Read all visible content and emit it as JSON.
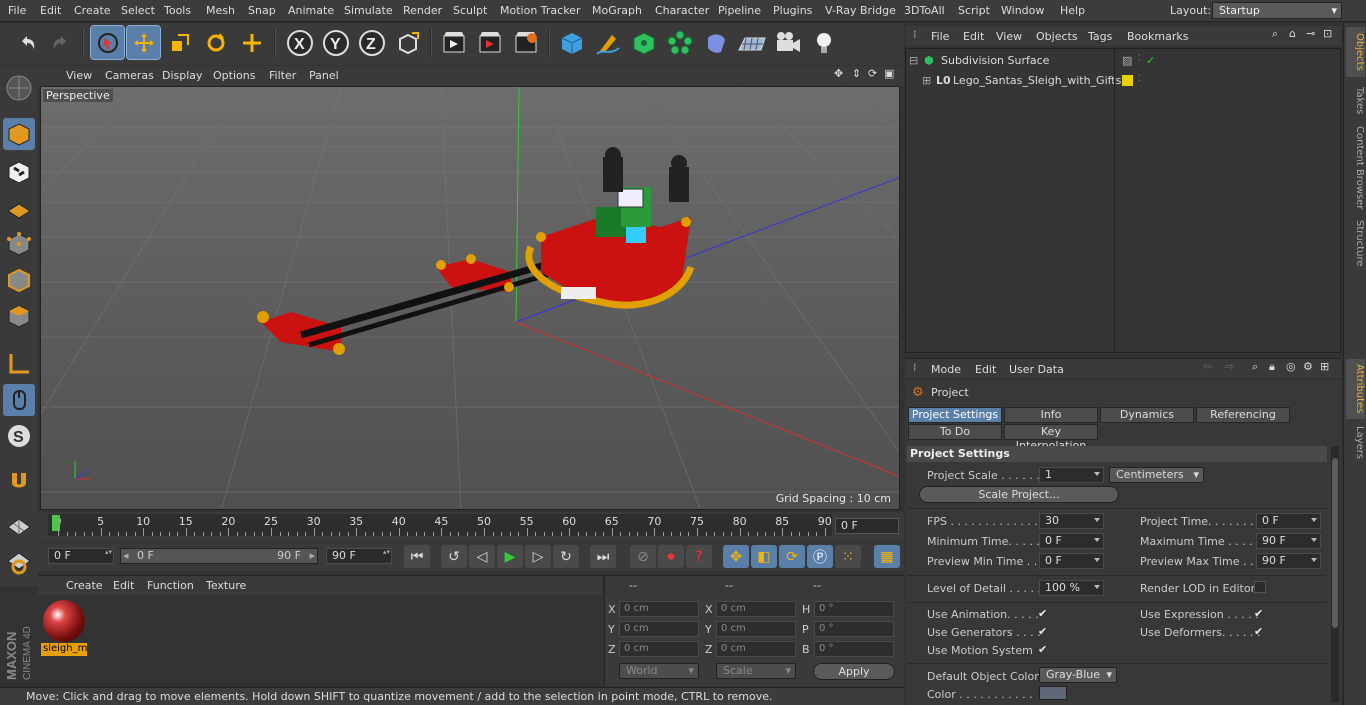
{
  "menubar": {
    "items": [
      "File",
      "Edit",
      "Create",
      "Select",
      "Tools",
      "Mesh",
      "Snap",
      "Animate",
      "Simulate",
      "Render",
      "Sculpt",
      "Motion Tracker",
      "MoGraph",
      "Character",
      "Pipeline",
      "Plugins",
      "V-Ray Bridge",
      "3DToAll",
      "Script",
      "Window",
      "Help"
    ],
    "layout_label": "Layout:",
    "layout_value": "Startup"
  },
  "toolbar": {
    "icons": [
      "undo-icon",
      "redo-icon",
      "live-selection-icon",
      "move-icon",
      "scale-icon",
      "rotate-icon",
      "last-tool-icon",
      "x-axis-icon",
      "y-axis-icon",
      "z-axis-icon",
      "coordinate-system-icon",
      "render-view-icon",
      "render-picture-viewer-icon",
      "edit-render-settings-icon",
      "cube-icon",
      "pen-icon",
      "subdivision-icon",
      "cloner-icon",
      "deformer-icon",
      "floor-icon",
      "camera-icon",
      "light-icon"
    ]
  },
  "viewport": {
    "menu": [
      "View",
      "Cameras",
      "Display",
      "Options",
      "Filter",
      "Panel"
    ],
    "label": "Perspective",
    "grid_spacing": "Grid Spacing : 10 cm"
  },
  "timeline": {
    "ticks": [
      "0",
      "5",
      "10",
      "15",
      "20",
      "25",
      "30",
      "35",
      "40",
      "45",
      "50",
      "55",
      "60",
      "65",
      "70",
      "75",
      "80",
      "85",
      "90"
    ],
    "current_frame": "0 F",
    "start": "0 F",
    "range_start": "0 F",
    "range_end": "90 F",
    "end": "90 F"
  },
  "material": {
    "menu": [
      "Create",
      "Edit",
      "Function",
      "Texture"
    ],
    "name": "sleigh_m"
  },
  "coords": {
    "headers": [
      "--",
      "--",
      "--"
    ],
    "rows": [
      {
        "a": "X",
        "av": "0 cm",
        "b": "X",
        "bv": "0 cm",
        "c": "H",
        "cv": "0 °"
      },
      {
        "a": "Y",
        "av": "0 cm",
        "b": "Y",
        "bv": "0 cm",
        "c": "P",
        "cv": "0 °"
      },
      {
        "a": "Z",
        "av": "0 cm",
        "b": "Z",
        "bv": "0 cm",
        "c": "B",
        "cv": "0 °"
      }
    ],
    "world": "World",
    "scale": "Scale",
    "apply": "Apply"
  },
  "status": "Move: Click and drag to move elements. Hold down SHIFT to quantize movement / add to the selection in point mode, CTRL to remove.",
  "objects": {
    "menu": [
      "File",
      "Edit",
      "View",
      "Objects",
      "Tags",
      "Bookmarks"
    ],
    "items": [
      {
        "name": "Subdivision Surface"
      },
      {
        "name": "Lego_Santas_Sleigh_with_Gifts"
      }
    ]
  },
  "attributes": {
    "menu": [
      "Mode",
      "Edit",
      "User Data"
    ],
    "title": "Project",
    "tabs": [
      "Project Settings",
      "Info",
      "Dynamics",
      "Referencing",
      "To Do",
      "Key Interpolation"
    ],
    "section": "Project Settings",
    "project_scale_label": "Project Scale . . . . . .",
    "project_scale_value": "1",
    "project_scale_unit": "Centimeters",
    "scale_project_btn": "Scale Project...",
    "fps_label": "FPS . . . . . . . . . . . . . .",
    "fps": "30",
    "project_time_label": "Project Time. . . . . . . .",
    "project_time": "0 F",
    "min_time_label": "Minimum Time. . . . . .",
    "min_time": "0 F",
    "max_time_label": "Maximum Time . . . . . .",
    "max_time": "90 F",
    "prev_min_label": "Preview Min Time . .",
    "prev_min": "0 F",
    "prev_max_label": "Preview Max Time . . .",
    "prev_max": "90 F",
    "lod_label": "Level of Detail . . . . .",
    "lod": "100 %",
    "render_lod_label": "Render LOD in Editor",
    "use_animation": "Use Animation. . . . .",
    "use_expression": "Use Expression . . . . .",
    "use_generators": "Use Generators . . . .",
    "use_deformers": "Use Deformers. . . . . .",
    "use_motion": "Use Motion System",
    "default_color_label": "Default Object Color",
    "default_color": "Gray-Blue",
    "color_label": "Color . . . . . . . . . . ."
  },
  "side_tabs": [
    "Objects",
    "Takes",
    "Content Browser",
    "Structure",
    "Attributes",
    "Layers"
  ],
  "brand": {
    "line1": "MAXON",
    "line2": "CINEMA 4D"
  },
  "colors": {
    "accent": "#5a7fa8",
    "selection": "#e8a000",
    "sleigh_red": "#cc1111"
  }
}
